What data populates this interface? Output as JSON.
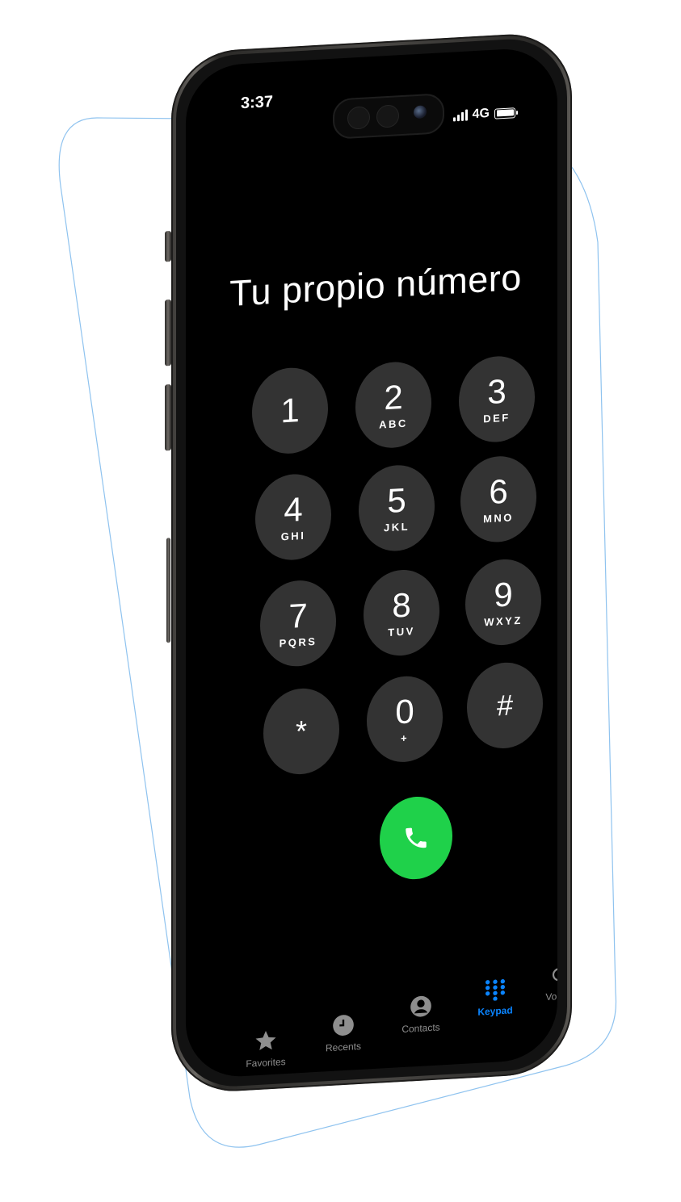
{
  "status_bar": {
    "time": "3:37",
    "network": "4G",
    "signal_icon": "signal-bars-icon",
    "battery_icon": "battery-icon"
  },
  "dialer": {
    "display_text": "Tu propio número"
  },
  "keypad": {
    "keys": [
      {
        "digit": "1",
        "letters": ""
      },
      {
        "digit": "2",
        "letters": "ABC"
      },
      {
        "digit": "3",
        "letters": "DEF"
      },
      {
        "digit": "4",
        "letters": "GHI"
      },
      {
        "digit": "5",
        "letters": "JKL"
      },
      {
        "digit": "6",
        "letters": "MNO"
      },
      {
        "digit": "7",
        "letters": "PQRS"
      },
      {
        "digit": "8",
        "letters": "TUV"
      },
      {
        "digit": "9",
        "letters": "WXYZ"
      },
      {
        "digit": "*",
        "letters": ""
      },
      {
        "digit": "0",
        "letters": "+"
      },
      {
        "digit": "#",
        "letters": ""
      }
    ]
  },
  "call_button": {
    "icon": "phone-icon",
    "color": "#1fd14a"
  },
  "tab_bar": {
    "active_color": "#0a84ff",
    "tabs": [
      {
        "label": "Favorites",
        "icon": "star-icon",
        "active": false
      },
      {
        "label": "Recents",
        "icon": "clock-icon",
        "active": false
      },
      {
        "label": "Contacts",
        "icon": "person-circle-icon",
        "active": false
      },
      {
        "label": "Keypad",
        "icon": "keypad-grid-icon",
        "active": true
      },
      {
        "label": "Voicemail",
        "icon": "voicemail-icon",
        "active": false
      }
    ]
  }
}
